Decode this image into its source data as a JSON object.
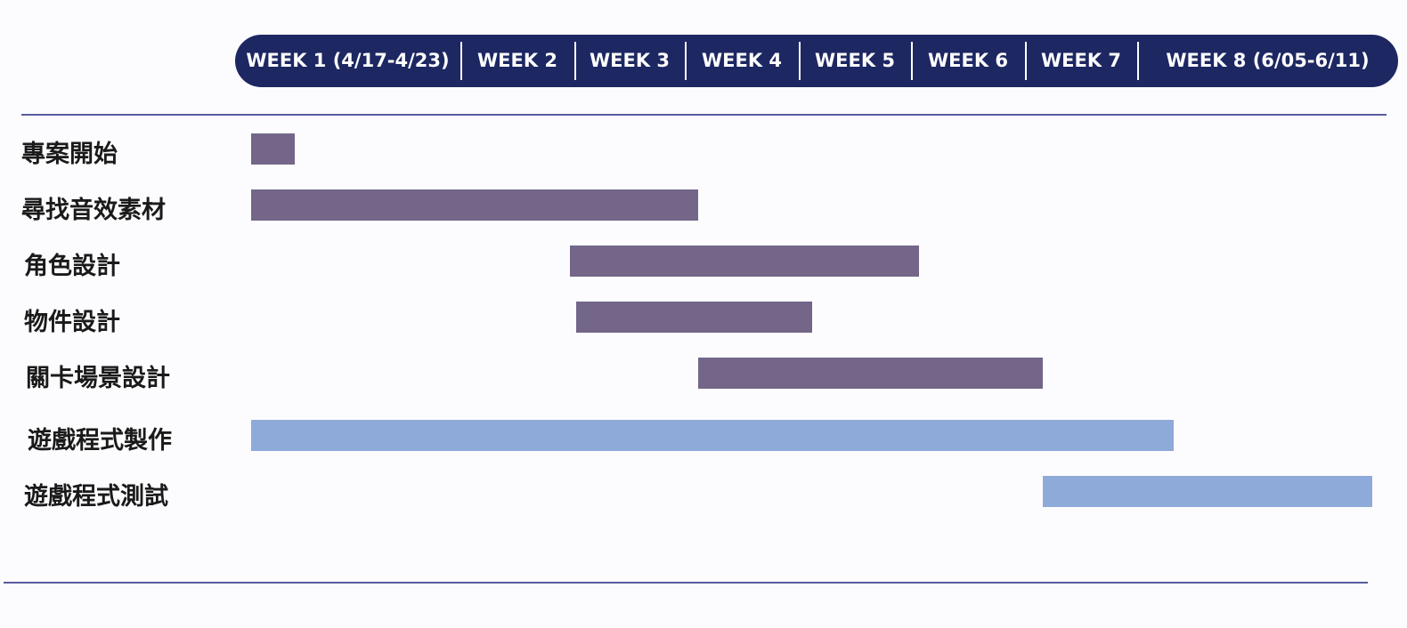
{
  "chart_data": {
    "type": "gantt",
    "title": "",
    "colors": {
      "header_bg": "#1d2762",
      "design_bar": "#736688",
      "dev_bar": "#8eaad9",
      "rule": "#5a5ba0"
    },
    "weeks": [
      "WEEK 1 (4/17-4/23)",
      "WEEK 2",
      "WEEK 3",
      "WEEK 4",
      "WEEK 5",
      "WEEK 6",
      "WEEK 7",
      "WEEK 8 (6/05-6/11)"
    ],
    "tasks": [
      {
        "name": "專案開始",
        "start_week": 0.05,
        "end_week": 0.25,
        "color": "#736688"
      },
      {
        "name": "尋找音效素材",
        "start_week": 0.05,
        "end_week": 3.1,
        "color": "#736688"
      },
      {
        "name": "角色設計",
        "start_week": 1.95,
        "end_week": 5.05,
        "color": "#736688"
      },
      {
        "name": "物件設計",
        "start_week": 2.0,
        "end_week": 4.1,
        "color": "#736688"
      },
      {
        "name": "關卡場景設計",
        "start_week": 3.1,
        "end_week": 6.15,
        "color": "#736688"
      },
      {
        "name": "遊戲程式製作",
        "start_week": 0.05,
        "end_week": 7.15,
        "color": "#8eaad9"
      },
      {
        "name": "遊戲程式測試",
        "start_week": 6.15,
        "end_week": 8.0,
        "color": "#8eaad9"
      }
    ]
  }
}
